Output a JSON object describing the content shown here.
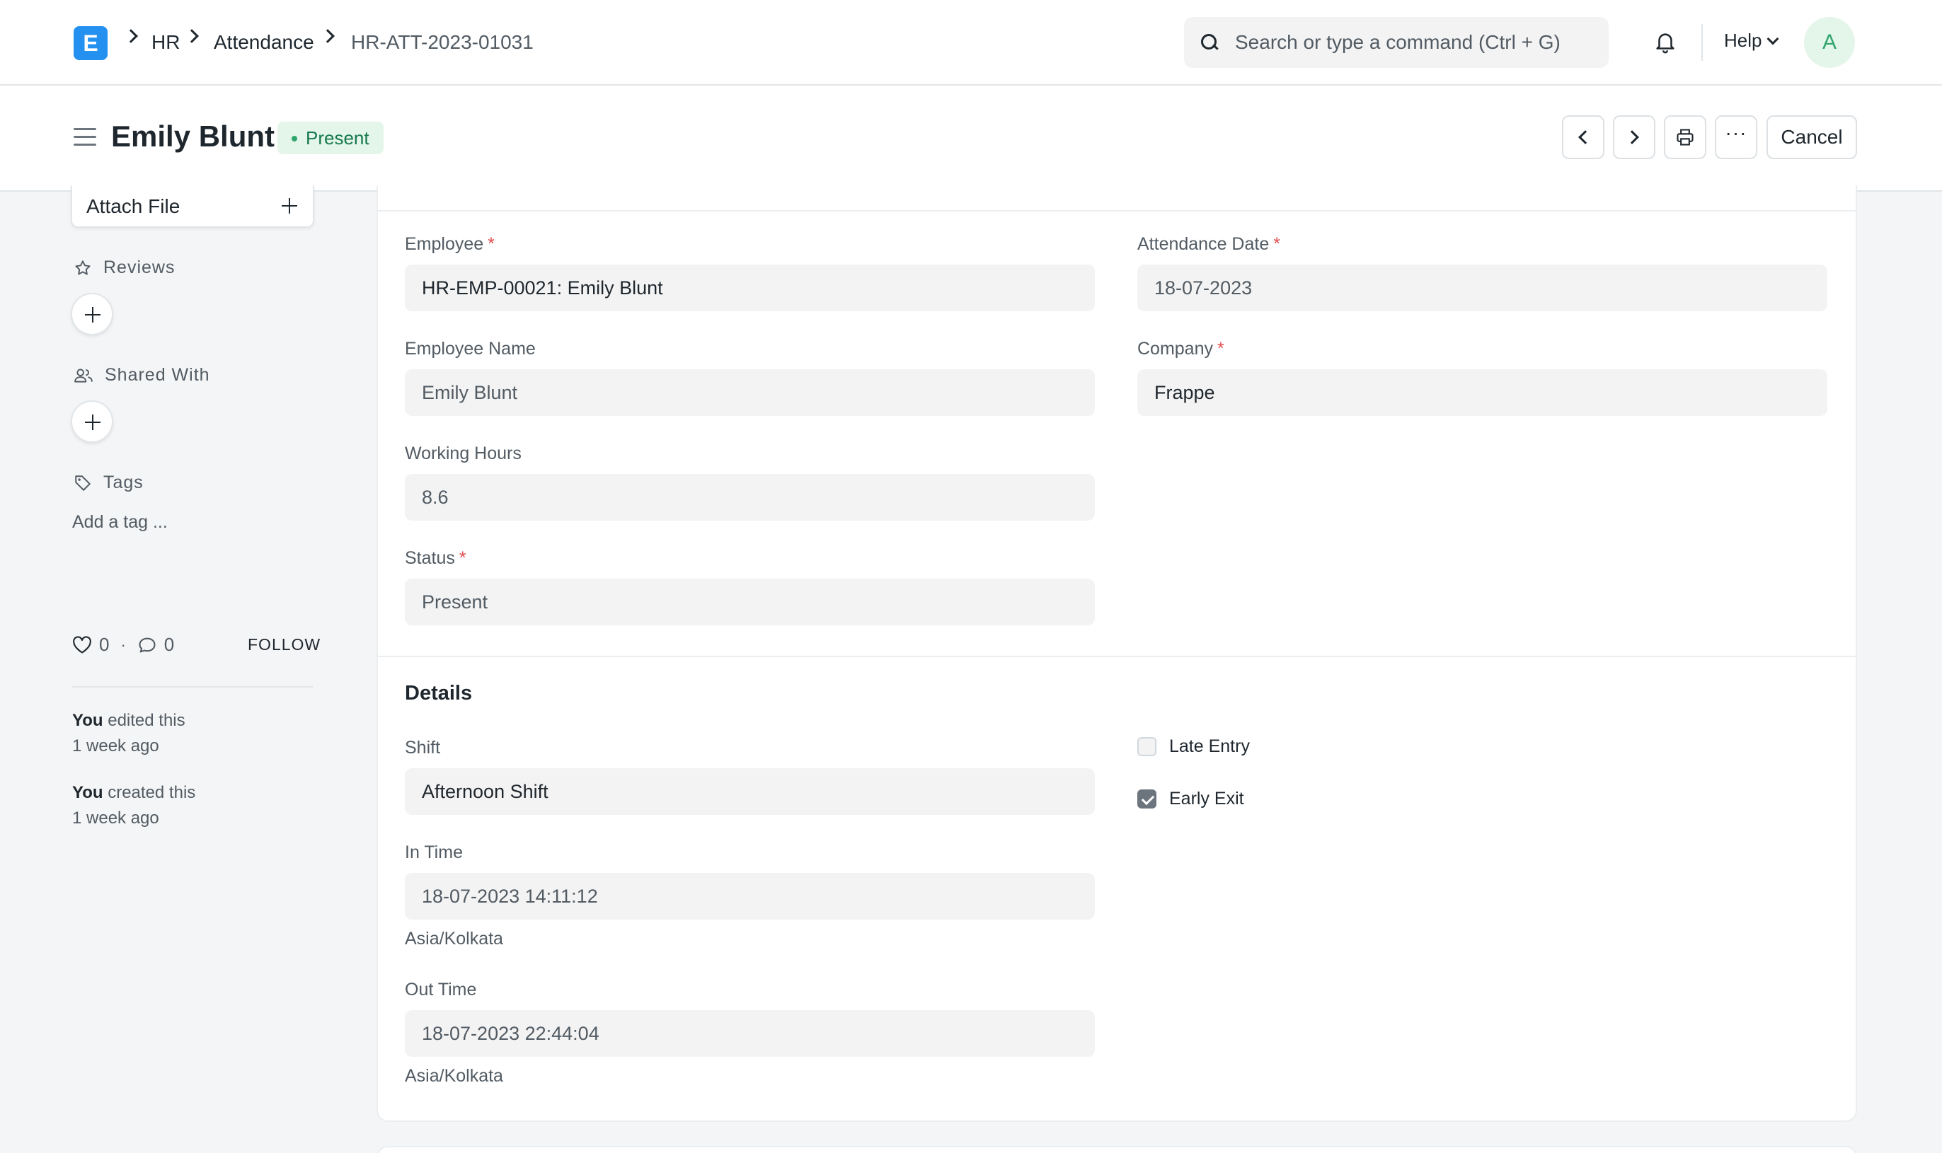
{
  "navbar": {
    "logo_letter": "E",
    "breadcrumbs": [
      "HR",
      "Attendance",
      "HR-ATT-2023-01031"
    ],
    "search_placeholder": "Search or type a command (Ctrl + G)",
    "help_label": "Help",
    "avatar_initial": "A"
  },
  "page": {
    "title": "Emily Blunt",
    "status": "Present",
    "cancel_label": "Cancel",
    "more_label": "···"
  },
  "sidebar": {
    "attach_label": "Attach File",
    "reviews_label": "Reviews",
    "shared_label": "Shared With",
    "tags_label": "Tags",
    "add_tag": "Add a tag ...",
    "likes": "0",
    "comments": "0",
    "follow_label": "FOLLOW",
    "timeline": [
      {
        "actor": "You",
        "action": " edited this",
        "when": "1 week ago"
      },
      {
        "actor": "You",
        "action": " created this",
        "when": "1 week ago"
      }
    ]
  },
  "form": {
    "employee": {
      "label": "Employee",
      "value": "HR-EMP-00021: Emily Blunt"
    },
    "attendance_date": {
      "label": "Attendance Date",
      "value": "18-07-2023"
    },
    "employee_name": {
      "label": "Employee Name",
      "value": "Emily Blunt"
    },
    "company": {
      "label": "Company",
      "value": "Frappe"
    },
    "working_hours": {
      "label": "Working Hours",
      "value": "8.6"
    },
    "status": {
      "label": "Status",
      "value": "Present"
    },
    "details_title": "Details",
    "shift": {
      "label": "Shift",
      "value": "Afternoon Shift"
    },
    "late_entry": {
      "label": "Late Entry",
      "checked": false
    },
    "early_exit": {
      "label": "Early Exit",
      "checked": true
    },
    "in_time": {
      "label": "In Time",
      "value": "18-07-2023 14:11:12",
      "timezone": "Asia/Kolkata"
    },
    "out_time": {
      "label": "Out Time",
      "value": "18-07-2023 22:44:04",
      "timezone": "Asia/Kolkata"
    },
    "required_mark": "*"
  }
}
